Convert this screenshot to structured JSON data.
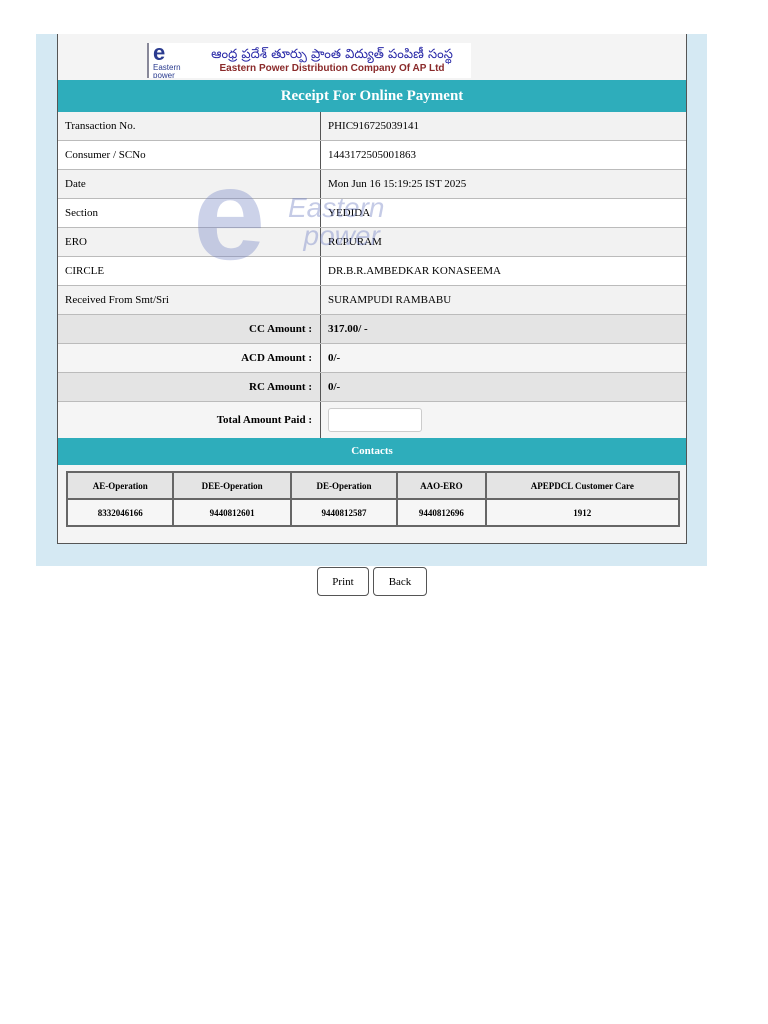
{
  "logo": {
    "telugu": "ఆంధ్ర ప్రదేశ్ తూర్పు ప్రాంత విద్యుత్ పంపిణీ సంస్థ",
    "english": "Eastern Power Distribution Company Of AP Ltd",
    "mark": "Eastern power"
  },
  "title": "Receipt For Online Payment",
  "rows": [
    {
      "label": "Transaction No.",
      "value": "PHIC916725039141"
    },
    {
      "label": "Consumer / SCNo",
      "value": "1443172505001863"
    },
    {
      "label": "Date",
      "value": "Mon Jun 16 15:19:25 IST 2025"
    },
    {
      "label": "Section",
      "value": "YEDIDA"
    },
    {
      "label": "ERO",
      "value": "RCPURAM"
    },
    {
      "label": "CIRCLE",
      "value": "DR.B.R.AMBEDKAR KONASEEMA"
    },
    {
      "label": "Received From Smt/Sri",
      "value": "SURAMPUDI RAMBABU"
    }
  ],
  "amounts": [
    {
      "label": "CC Amount :",
      "value": "317.00/ -"
    },
    {
      "label": "ACD Amount :",
      "value": "0/-"
    },
    {
      "label": "RC Amount :",
      "value": "0/-"
    }
  ],
  "total": {
    "label": "Total Amount Paid :",
    "value": ""
  },
  "contacts": {
    "title": "Contacts",
    "headers": [
      "AE-Operation",
      "DEE-Operation",
      "DE-Operation",
      "AAO-ERO",
      "APEPDCL Customer Care"
    ],
    "values": [
      "8332046166",
      "9440812601",
      "9440812587",
      "9440812696",
      "1912"
    ]
  },
  "buttons": {
    "print": "Print",
    "back": "Back"
  }
}
